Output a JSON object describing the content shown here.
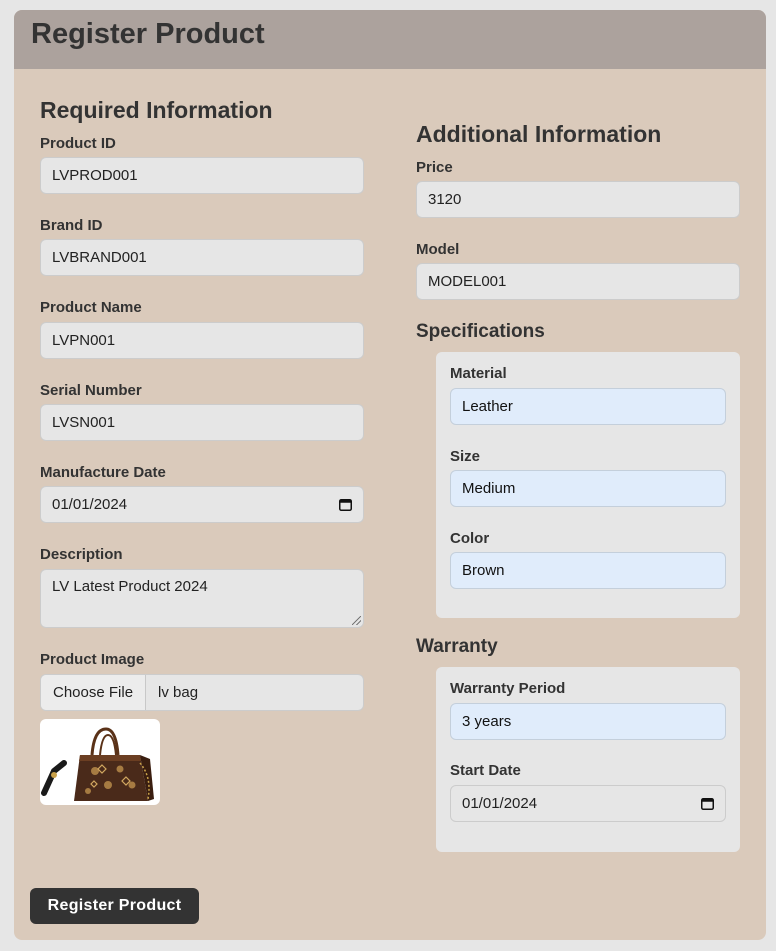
{
  "header": {
    "title": "Register Product"
  },
  "required": {
    "title": "Required Information",
    "product_id": {
      "label": "Product ID",
      "value": "LVPROD001"
    },
    "brand_id": {
      "label": "Brand ID",
      "value": "LVBRAND001"
    },
    "product_name": {
      "label": "Product Name",
      "value": "LVPN001"
    },
    "serial_number": {
      "label": "Serial Number",
      "value": "LVSN001"
    },
    "manufacture_date": {
      "label": "Manufacture Date",
      "value": "01/01/2024"
    },
    "description": {
      "label": "Description",
      "value": "LV Latest Product 2024"
    },
    "product_image": {
      "label": "Product Image",
      "button": "Choose File",
      "file_name": "lv bag"
    }
  },
  "additional": {
    "title": "Additional Information",
    "price": {
      "label": "Price",
      "value": "3120"
    },
    "model": {
      "label": "Model",
      "value": "MODEL001"
    }
  },
  "specifications": {
    "title": "Specifications",
    "material": {
      "label": "Material",
      "value": "Leather"
    },
    "size": {
      "label": "Size",
      "value": "Medium"
    },
    "color": {
      "label": "Color",
      "value": "Brown"
    }
  },
  "warranty": {
    "title": "Warranty",
    "period": {
      "label": "Warranty Period",
      "value": "3 years"
    },
    "start_date": {
      "label": "Start Date",
      "value": "01/01/2024"
    }
  },
  "actions": {
    "submit": "Register Product"
  },
  "icons": {
    "calendar": "calendar-icon",
    "resize": "resize-grip-icon",
    "image": "product-thumbnail"
  },
  "colors": {
    "card_bg": "#dacabb",
    "header_bg": "#aca29d",
    "field_bg": "#e6e6e6",
    "spec_field_bg": "#e0ecfb",
    "button_bg": "#333333"
  }
}
